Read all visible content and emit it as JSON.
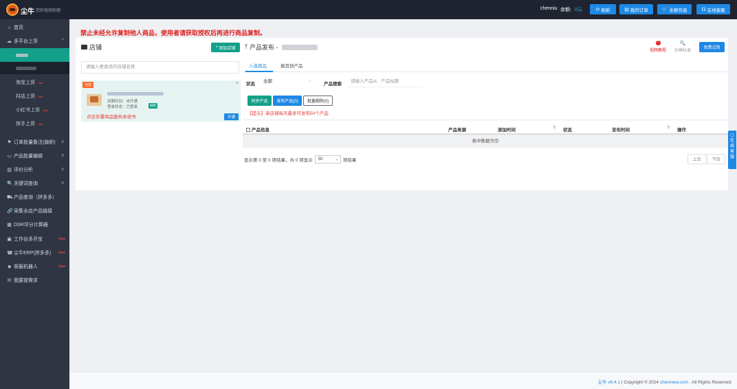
{
  "topbar": {
    "brand": "尘牛",
    "slogan": "您的电商助理",
    "username": "chenniu",
    "balance_label": "余额:",
    "balance_value": "0元",
    "buttons": [
      {
        "icon": "refresh-icon",
        "glyph": "⟳",
        "label": "刷新"
      },
      {
        "icon": "order-icon",
        "glyph": "▤",
        "label": "我的订单"
      },
      {
        "icon": "cart-icon",
        "glyph": "🛒",
        "label": "余额充值"
      },
      {
        "icon": "headset-icon",
        "glyph": "☊",
        "label": "在线客服"
      }
    ]
  },
  "sidebar": {
    "home": {
      "glyph": "⌂",
      "label": "首页"
    },
    "multi_platform": {
      "glyph": "☁",
      "label": "多平台上货"
    },
    "sub_items": [
      {
        "label": "淘宝上货",
        "badge": "hot"
      },
      {
        "label": "抖店上货",
        "badge": "hot"
      },
      {
        "label": "小红书上货",
        "badge": "hot"
      },
      {
        "label": "快手上货",
        "badge": "hot"
      }
    ],
    "menu": [
      {
        "glyph": "⚑",
        "label": "订单批量备注(旗帜)",
        "chevron": true
      },
      {
        "glyph": "▭",
        "label": "产品批量编辑",
        "chevron": true
      },
      {
        "glyph": "▥",
        "label": "评价分析",
        "chevron": true
      },
      {
        "glyph": "🔍",
        "label": "关键词查询",
        "chevron": true
      },
      {
        "glyph": "⛟",
        "label": "产品查询（拼多多）"
      },
      {
        "glyph": "🔗",
        "label": "采集全店产品链接"
      },
      {
        "glyph": "▦",
        "label": "DSR评分计算器"
      },
      {
        "glyph": "▣",
        "label": "工作台多开宝",
        "new": "New"
      },
      {
        "glyph": "☎",
        "label": "尘牛ERP(拼多多)",
        "new": "New"
      },
      {
        "glyph": "☻",
        "label": "客服机器人",
        "new": "New"
      },
      {
        "glyph": "✉",
        "label": "我要提需求"
      }
    ]
  },
  "notice": "禁止未经允许复制他人商品，使用者请获取授权后再进行商品复制。",
  "shop_panel": {
    "title": "店铺",
    "add_button": "添加店铺",
    "add_glyph": "+",
    "search_placeholder": "请输入要查找的店铺名称",
    "card": {
      "tag": "当前",
      "line1": "到期时间：未开通",
      "line2": "登录状态：已登录",
      "auth_badge": "刷新",
      "link": "点击答署商品服务承诺书",
      "open_button": "开通"
    }
  },
  "product_panel": {
    "title": "产品发布 -",
    "help_label": "视频教程",
    "help_glyph": "?",
    "price_label": "价格标准",
    "price_glyph": "🔍",
    "free_trial": "免费试用",
    "tabs": [
      "入选商品",
      "搬其他产品"
    ],
    "status_label": "状态",
    "status_value": "全部",
    "search_label": "产品搜索",
    "search_placeholder": "请输入产品id、产品标题",
    "buttons": {
      "sync": "同步产品",
      "publish": "发布产品(0)",
      "batch_delete": "批量删除(0)"
    },
    "tip": "【提示】单店铺每天最多可发布50个产品",
    "table": {
      "columns": [
        "产品信息",
        "产品来源",
        "添加时间",
        "状态",
        "发布时间",
        "操作"
      ],
      "empty": "表中数据为空"
    },
    "pagination": {
      "summary_prefix": "显示第 0 至 0 项结果，共 0 项显示",
      "page_size": "50",
      "summary_suffix": "项结果",
      "prev": "上页",
      "next": "下页"
    }
  },
  "float_service": "在线客服",
  "footer": {
    "version": "尘牛 v6.4.1",
    "copyright": "| Copyright © 2024",
    "domain": "chenniew.com",
    "rights": ". All Rights Reserved."
  },
  "colors": {
    "accent_teal": "#13a08a",
    "primary_blue": "#1e88e5",
    "warning_red": "#e02020",
    "sidebar_bg": "#2f3542",
    "topbar_bg": "#1f2430"
  }
}
